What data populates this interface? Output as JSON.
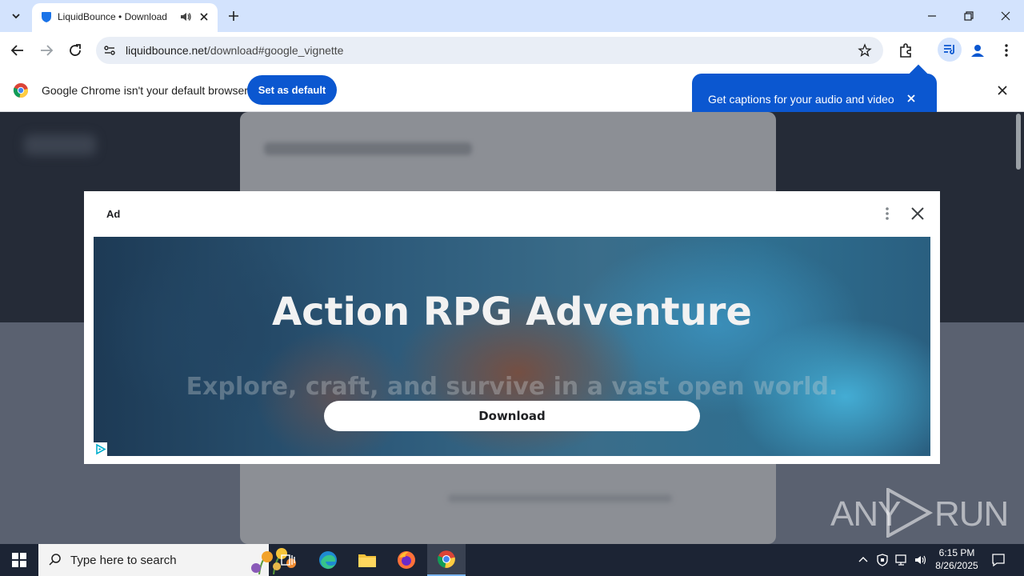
{
  "browser": {
    "tab": {
      "title": "LiquidBounce • Download"
    },
    "address": {
      "host": "liquidbounce.net",
      "path": "/download#google_vignette"
    }
  },
  "infobar": {
    "message": "Google Chrome isn't your default browser",
    "button_label": "Set as default"
  },
  "caption_bubble": {
    "text": "Get captions for your audio and video"
  },
  "ad": {
    "label": "Ad",
    "headline": "Action RPG Adventure",
    "subheadline": "Explore, craft, and survive in a vast open world.",
    "cta_label": "Download"
  },
  "watermark": {
    "left": "ANY",
    "right": "RUN"
  },
  "taskbar": {
    "search_placeholder": "Type here to search",
    "time": "6:15 PM",
    "date": "8/26/2025",
    "apps": [
      "task-view",
      "edge",
      "file-explorer",
      "firefox",
      "chrome"
    ]
  },
  "colors": {
    "accent": "#0b57d0",
    "tabstrip": "#d3e3fd",
    "taskbar": "#1c2434"
  }
}
